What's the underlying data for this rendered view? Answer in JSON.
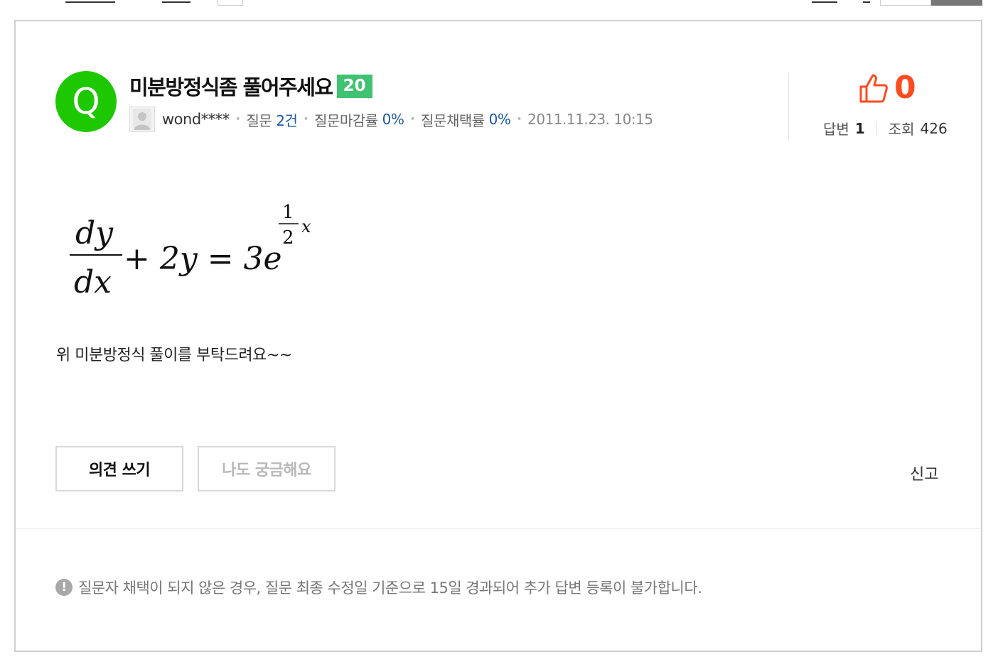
{
  "question": {
    "badge_letter": "Q",
    "title": "미분방정식좀 풀어주세요",
    "points": "20",
    "body": "위 미분방정식 풀이를 부탁드려요~~"
  },
  "meta": {
    "author": "wond****",
    "question_label": "질문",
    "question_count": "2건",
    "close_rate_label": "질문마감률",
    "close_rate": "0%",
    "adopt_rate_label": "질문채택률",
    "adopt_rate": "0%",
    "datetime": "2011.11.23. 10:15"
  },
  "stats": {
    "likes": "0",
    "answers_label": "답변",
    "answers": "1",
    "views_label": "조회",
    "views": "426"
  },
  "equation": {
    "numerator": "dy",
    "denominator": "dx",
    "rest": "+ 2y = 3e",
    "exp_numerator": "1",
    "exp_denominator": "2",
    "exp_var": "x"
  },
  "actions": {
    "opinion_label": "의견 쓰기",
    "curious_label": "나도 궁금해요",
    "report_label": "신고"
  },
  "notice": {
    "icon_symbol": "!",
    "text": "질문자 채택이 되지 않은 경우, 질문 최종 수정일 기준으로 15일 경과되어 추가 답변 등록이 불가합니다."
  },
  "colors": {
    "q_badge": "#1ec800",
    "points_badge": "#41c270",
    "like": "#ff4b1f",
    "meta_blue": "#1b59a8"
  },
  "icons": [
    "thumbs-up-icon",
    "avatar-placeholder-icon",
    "warning-icon"
  ]
}
